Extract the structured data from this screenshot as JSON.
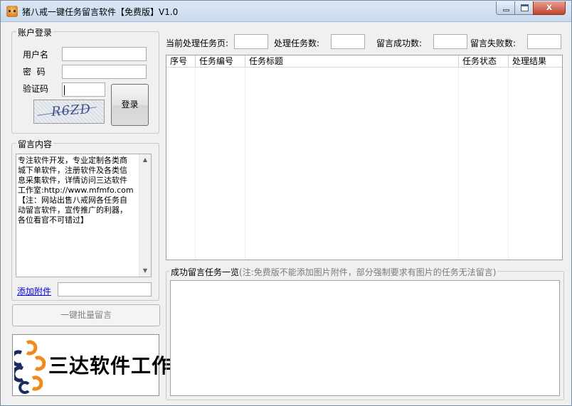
{
  "window": {
    "title": "猪八戒一键任务留言软件【免费版】V1.0",
    "minimize_glyph": "–",
    "maximize_glyph": "□",
    "close_glyph": "x"
  },
  "account": {
    "legend": "账户登录",
    "username_label": "用户名",
    "username_value": "",
    "password_label": "密  码",
    "password_value": "",
    "captcha_label": "验证码",
    "captcha_value": "",
    "captcha_image_text": "R6ZD",
    "login_button": "登录"
  },
  "message": {
    "legend": "留言内容",
    "content": "专注软件开发，专业定制各类商\n城下单软件，注册软件及各类信\n息采集软件，详情访问三达软件\n工作室:http://www.mfmfo.com\n【注：网站出售八戒网各任务自\n动留言软件，宣传推广的利器，\n各位看官不可错过】",
    "attach_link": "添加附件",
    "attach_value": ""
  },
  "batch_button": "一键批量留言",
  "logo": {
    "text": "三达软件工作室"
  },
  "stats": {
    "current_page_label": "当前处理任务页:",
    "current_page_value": "",
    "processed_label": "处理任务数:",
    "processed_value": "",
    "success_label": "留言成功数:",
    "success_value": "",
    "fail_label": "留言失败数:",
    "fail_value": ""
  },
  "task_table": {
    "columns": [
      "序号",
      "任务编号",
      "任务标题",
      "任务状态",
      "处理结果"
    ],
    "rows": []
  },
  "success_list": {
    "legend": "成功留言任务一览",
    "note": "(注:免费版不能添加图片附件，部分强制要求有图片的任务无法留言)",
    "items": []
  },
  "colors": {
    "logo_orange": "#f08a1c",
    "logo_navy": "#1d2a5e",
    "link_blue": "#0000ee"
  }
}
